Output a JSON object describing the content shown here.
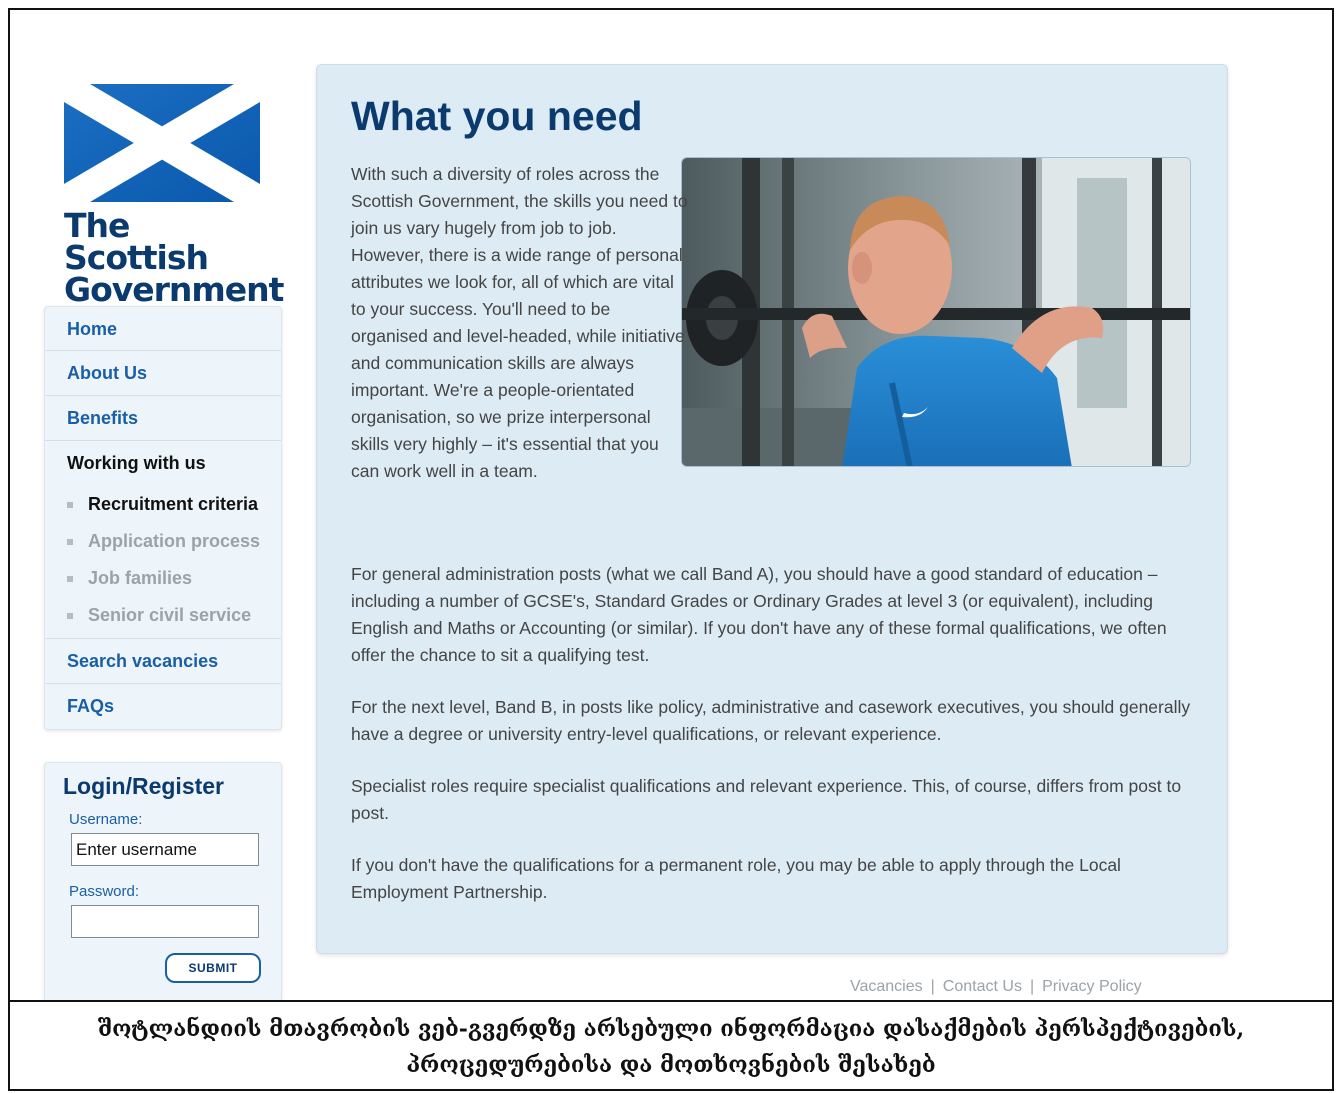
{
  "logo": {
    "line1": "The Scottish",
    "line2": "Government"
  },
  "nav": {
    "items": [
      "Home",
      "About Us",
      "Benefits"
    ],
    "current_section": "Working with us",
    "sub_items": [
      "Recruitment criteria",
      "Application process",
      "Job families",
      "Senior civil service"
    ],
    "after_items": [
      "Search vacancies",
      "FAQs"
    ]
  },
  "login": {
    "title": "Login/Register",
    "username_label": "Username:",
    "username_value": "Enter username",
    "password_label": "Password:",
    "submit_label": "SUBMIT"
  },
  "main": {
    "title": "What you need",
    "intro": "With such a diversity of roles across the Scottish Government, the skills you need to join us vary hugely from job to job. However, there is a wide range of personal attributes we look for, all of which are vital to your success. You'll need to be organised and level-headed, while initiative and communication skills are always important. We're a people-orientated organisation, so we prize interpersonal skills very highly – it's essential that you can work well in a team.",
    "paragraphs": [
      "For general administration posts (what we call Band A), you should have a good standard of education – including a number of GCSE's, Standard Grades or Ordinary Grades at level 3 (or equivalent), including English and Maths or Accounting (or similar). If you don't have any of these formal qualifications, we often offer the chance to sit a qualifying test.",
      "For the next level, Band B, in posts like policy, administrative and casework executives, you should generally have a degree or university entry-level qualifications, or relevant experience.",
      "Specialist roles require specialist qualifications and relevant experience. This, of course, differs from post to post.",
      "If you don't have the qualifications for a permanent role, you may be able to apply through the Local Employment Partnership."
    ]
  },
  "footer": {
    "links": [
      "Vacancies",
      "Contact Us",
      "Privacy Policy"
    ],
    "separator": "|"
  },
  "caption": "შოტლანდიის მთავრობის ვებ-გვერდზე არსებული ინფორმაცია დასაქმების პერსპექტივების, პროცედურებისა და მოთხოვნების შესახებ",
  "colors": {
    "brand_navy": "#0b3a6e",
    "link_blue": "#1a5fa6",
    "panel_bg": "#ddebf5",
    "nav_bg": "#eef5fa"
  }
}
